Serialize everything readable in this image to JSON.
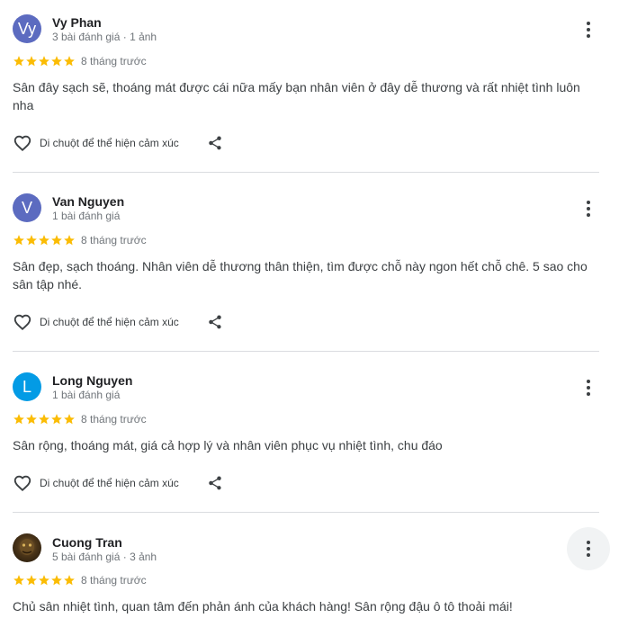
{
  "reviews": [
    {
      "avatar_letter": "Vy",
      "avatar_color": "#5c6bc0",
      "name": "Vy Phan",
      "meta": "3 bài đánh giá · 1 ảnh",
      "rating": 5,
      "date": "8 tháng trước",
      "text": "Sân đây sạch sẽ, thoáng mát được cái nữa mấy bạn nhân viên ở đây dễ thương và rất nhiệt tình luôn nha",
      "react_label": "Di chuột để thể hiện cảm xúc"
    },
    {
      "avatar_letter": "V",
      "avatar_color": "#5c6bc0",
      "name": "Van Nguyen",
      "meta": "1 bài đánh giá",
      "rating": 5,
      "date": "8 tháng trước",
      "text": "Sân đẹp, sạch thoáng. Nhân viên dễ thương thân thiện, tìm được chỗ này ngon hết chỗ chê. 5 sao cho sân tập nhé.",
      "react_label": "Di chuột để thể hiện cảm xúc"
    },
    {
      "avatar_letter": "L",
      "avatar_color": "#039be5",
      "name": "Long Nguyen",
      "meta": "1 bài đánh giá",
      "rating": 5,
      "date": "8 tháng trước",
      "text": "Sân rộng, thoáng mát, giá cả hợp lý và nhân viên phục vụ nhiệt tình, chu đáo",
      "react_label": "Di chuột để thể hiện cảm xúc"
    },
    {
      "avatar_letter": "",
      "avatar_color": "#3a2a1a",
      "name": "Cuong Tran",
      "meta": "5 bài đánh giá · 3 ảnh",
      "rating": 5,
      "date": "8 tháng trước",
      "text": "Chủ sân nhiệt tình, quan tâm đến phản ánh của khách hàng! Sân rộng đậu ô tô thoải mái!",
      "react_label": ""
    }
  ],
  "colors": {
    "star": "#fbbc04",
    "divider": "#dadce0",
    "secondary_text": "#70757a"
  },
  "icons": {
    "like": "heart-outline-icon",
    "share": "share-icon",
    "more": "more-vert-icon",
    "star": "star-icon"
  }
}
